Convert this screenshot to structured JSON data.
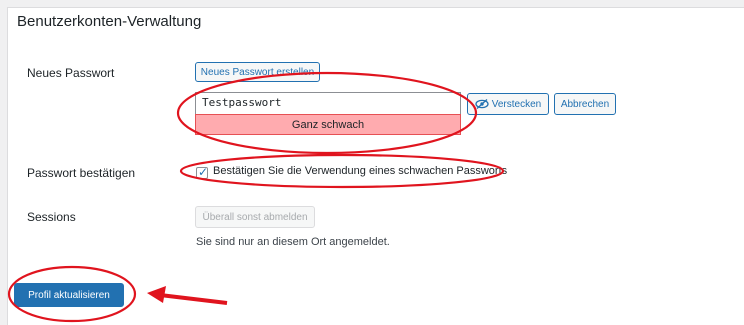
{
  "section": {
    "title": "Benutzerkonten-Verwaltung"
  },
  "new_password": {
    "label": "Neues Passwort",
    "generate_button": "Neues Passwort erstellen",
    "value": "Testpasswort",
    "strength": "Ganz schwach",
    "hide_button": "Verstecken",
    "cancel_button": "Abbrechen"
  },
  "confirm_password": {
    "label": "Passwort bestätigen",
    "checkbox_label": "Bestätigen Sie die Verwendung eines schwachen Passworts",
    "checked": true
  },
  "sessions": {
    "label": "Sessions",
    "logout_button": "Überall sonst abmelden",
    "note": "Sie sind nur an diesem Ort angemeldet."
  },
  "submit": {
    "label": "Profil aktualisieren"
  },
  "colors": {
    "accent": "#2271b1",
    "strength_bg": "#ffabaf",
    "annotation_red": "#e0141e"
  },
  "icons": [
    "eye-slash-icon",
    "checkmark-icon",
    "arrow-icon"
  ]
}
